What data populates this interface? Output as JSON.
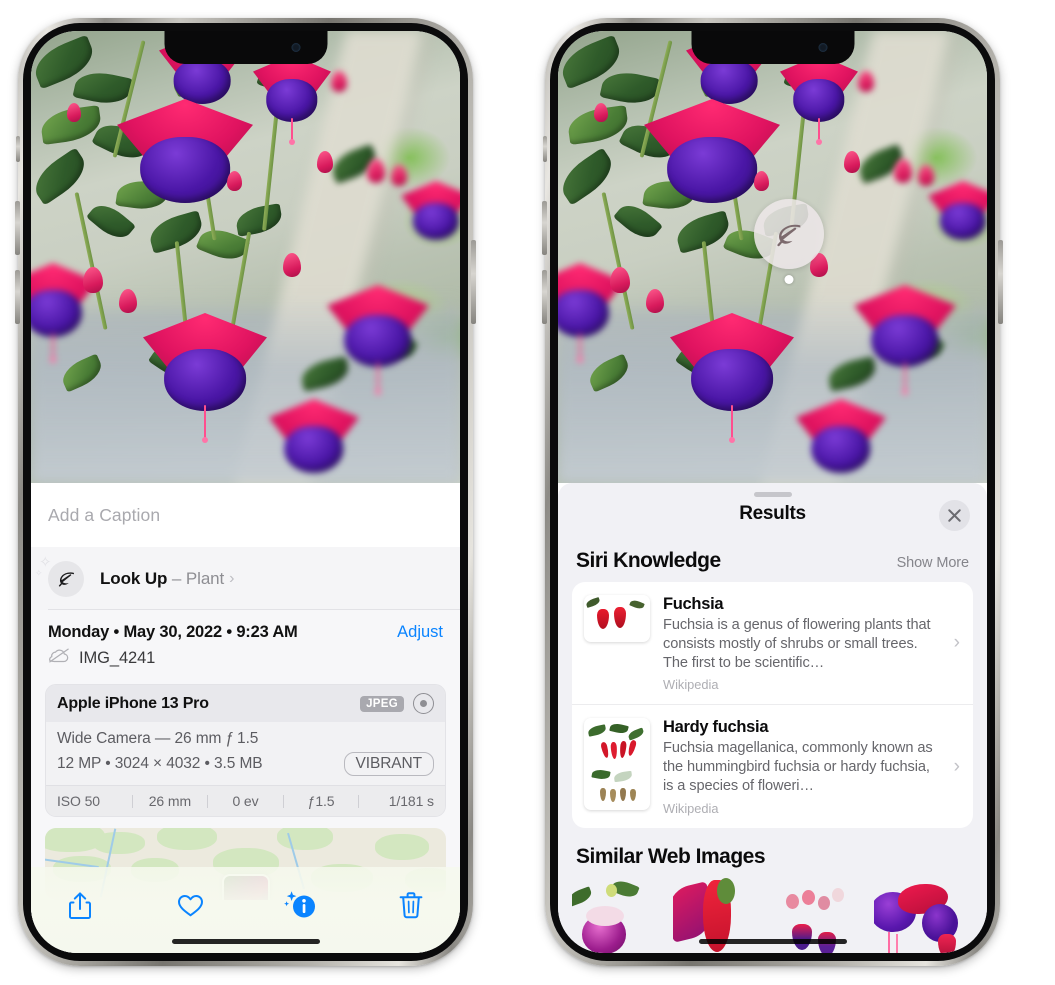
{
  "left_phone": {
    "photo": {
      "subject": "fuchsia-flowers-hanging-basket",
      "alt": "Pink and purple fuchsia flowers hanging from a basket on a porch"
    },
    "caption_field": {
      "placeholder": "Add a Caption",
      "value": ""
    },
    "lookup_row": {
      "icon": "leaf-icon",
      "sparkle_icon": "sparkles-icon",
      "label": "Look Up",
      "separator": "–",
      "subject": "Plant",
      "chevron": "›"
    },
    "metadata": {
      "date_line": "Monday • May 30, 2022 • 9:23 AM",
      "adjust_label": "Adjust",
      "cloud_icon": "cloud-slash-icon",
      "filename": "IMG_4241"
    },
    "camera_card": {
      "model": "Apple iPhone 13 Pro",
      "format_badge": "JPEG",
      "raw_icon": "aperture-icon",
      "lens_line": "Wide Camera — 26 mm ƒ 1.5",
      "size_line": "12 MP • 3024 × 4032 • 3.5 MB",
      "style_badge": "VIBRANT",
      "exif": [
        "ISO 50",
        "26 mm",
        "0 ev",
        "ƒ1.5",
        "1/181 s"
      ]
    },
    "map_card": {
      "label": "photo-location-map",
      "pin": "photo-thumbnail-pin"
    },
    "toolbar": [
      {
        "name": "share-button",
        "icon": "share-icon"
      },
      {
        "name": "favorite-button",
        "icon": "heart-icon"
      },
      {
        "name": "info-button",
        "icon": "info-sparkle-icon"
      },
      {
        "name": "delete-button",
        "icon": "trash-icon"
      }
    ],
    "accent_color": "#0a84ff"
  },
  "right_phone": {
    "photo": {
      "subject": "fuchsia-flowers-hanging-basket",
      "lookup_pin": {
        "icon": "leaf-icon",
        "name": "visual-lookup-pin"
      }
    },
    "sheet": {
      "grabber": "drag-handle",
      "title": "Results",
      "close_icon": "close-icon",
      "siri_knowledge": {
        "title": "Siri Knowledge",
        "show_more": "Show More",
        "items": [
          {
            "title": "Fuchsia",
            "description": "Fuchsia is a genus of flowering plants that consists mostly of shrubs or small trees. The first to be scientific…",
            "source": "Wikipedia",
            "thumb": "fuchsia-red-flowers-thumbnail",
            "chevron": "›"
          },
          {
            "title": "Hardy fuchsia",
            "description": "Fuchsia magellanica, commonly known as the hummingbird fuchsia or hardy fuchsia, is a species of floweri…",
            "source": "Wikipedia",
            "thumb": "hardy-fuchsia-specimen-thumbnail",
            "chevron": "›"
          }
        ]
      },
      "similar_web_images": {
        "title": "Similar Web Images",
        "thumbnails": [
          "fuchsia-magenta-white-bloom",
          "fuchsia-red-closeup",
          "fuchsia-bush-buds",
          "fuchsia-purple-magenta-cluster"
        ]
      }
    }
  }
}
